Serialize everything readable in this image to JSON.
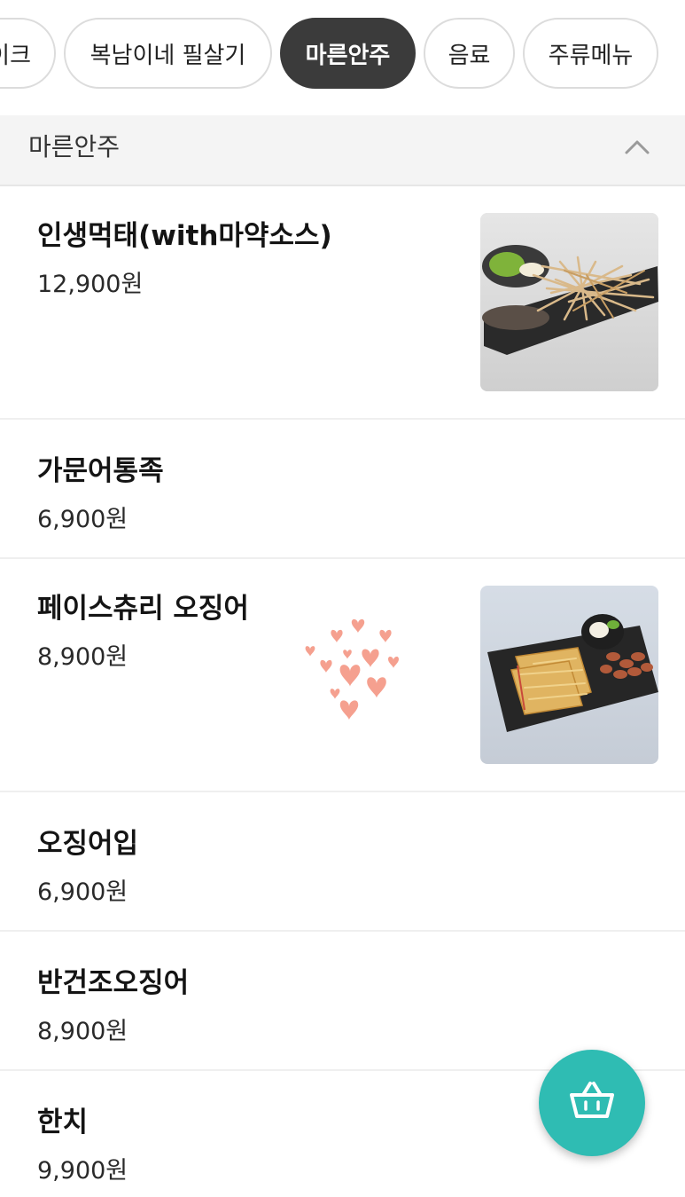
{
  "tabs": [
    {
      "label": "이크",
      "active": false
    },
    {
      "label": "복남이네 필살기",
      "active": false
    },
    {
      "label": "마른안주",
      "active": true
    },
    {
      "label": "음료",
      "active": false
    },
    {
      "label": "주류메뉴",
      "active": false
    }
  ],
  "section": {
    "title": "마른안주",
    "collapse_icon": "chevron-up-icon"
  },
  "menu_items": [
    {
      "name": "인생먹태(with마약소스)",
      "price": "12,900원",
      "has_image": true
    },
    {
      "name": "가문어통족",
      "price": "6,900원",
      "has_image": false
    },
    {
      "name": "페이스츄리 오징어",
      "price": "8,900원",
      "has_image": true
    },
    {
      "name": "오징어입",
      "price": "6,900원",
      "has_image": false
    },
    {
      "name": "반건조오징어",
      "price": "8,900원",
      "has_image": false
    },
    {
      "name": "한치",
      "price": "9,900원",
      "has_image": false
    }
  ],
  "decoration": {
    "icon": "hearts-icon",
    "color": "#f5a08f"
  },
  "cart_button": {
    "icon": "basket-icon",
    "color": "#2fbcb3"
  },
  "colors": {
    "active_tab": "#3b3b3b",
    "section_bg": "#f4f4f4",
    "accent": "#2fbcb3"
  }
}
